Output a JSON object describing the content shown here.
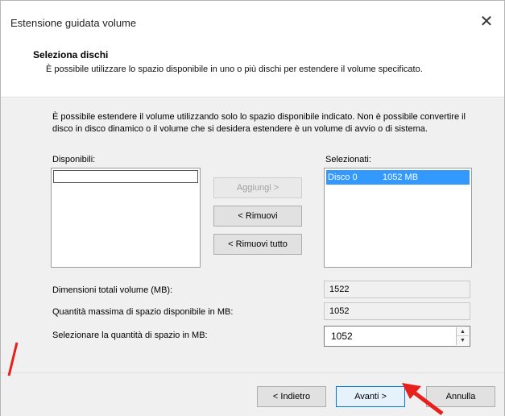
{
  "window": {
    "title": "Estensione guidata volume",
    "close_glyph": "✕"
  },
  "header": {
    "title": "Seleziona dischi",
    "description": "È possibile utilizzare lo spazio disponibile in uno o più dischi per estendere il volume specificato."
  },
  "content": {
    "intro": "È possibile estendere il volume utilizzando solo lo spazio disponibile indicato. Non è possibile convertire il disco in disco dinamico o il volume che si desidera estendere è un volume di avvio o di sistema.",
    "available_label": "Disponibili:",
    "selected_label": "Selezionati:",
    "available_items": [
      ""
    ],
    "selected_items": [
      {
        "disk": "Disco 0",
        "size": "1052 MB"
      }
    ],
    "buttons": {
      "add": "Aggiungi >",
      "remove": "< Rimuovi",
      "remove_all": "< Rimuovi tutto"
    },
    "fields": {
      "total_label": "Dimensioni totali volume (MB):",
      "total_value": "1522",
      "max_label": "Quantità massima di spazio disponibile in MB:",
      "max_value": "1052",
      "select_label": "Selezionare la quantità di spazio in MB:",
      "select_value": "1052"
    }
  },
  "footer": {
    "back": "< Indietro",
    "next": "Avanti >",
    "cancel": "Annulla"
  },
  "colors": {
    "selection": "#3399ff",
    "annotation_arrow": "#e8201b"
  },
  "icons": {
    "close": "close-icon",
    "spin_up": "chevron-up-icon",
    "spin_down": "chevron-down-icon"
  }
}
